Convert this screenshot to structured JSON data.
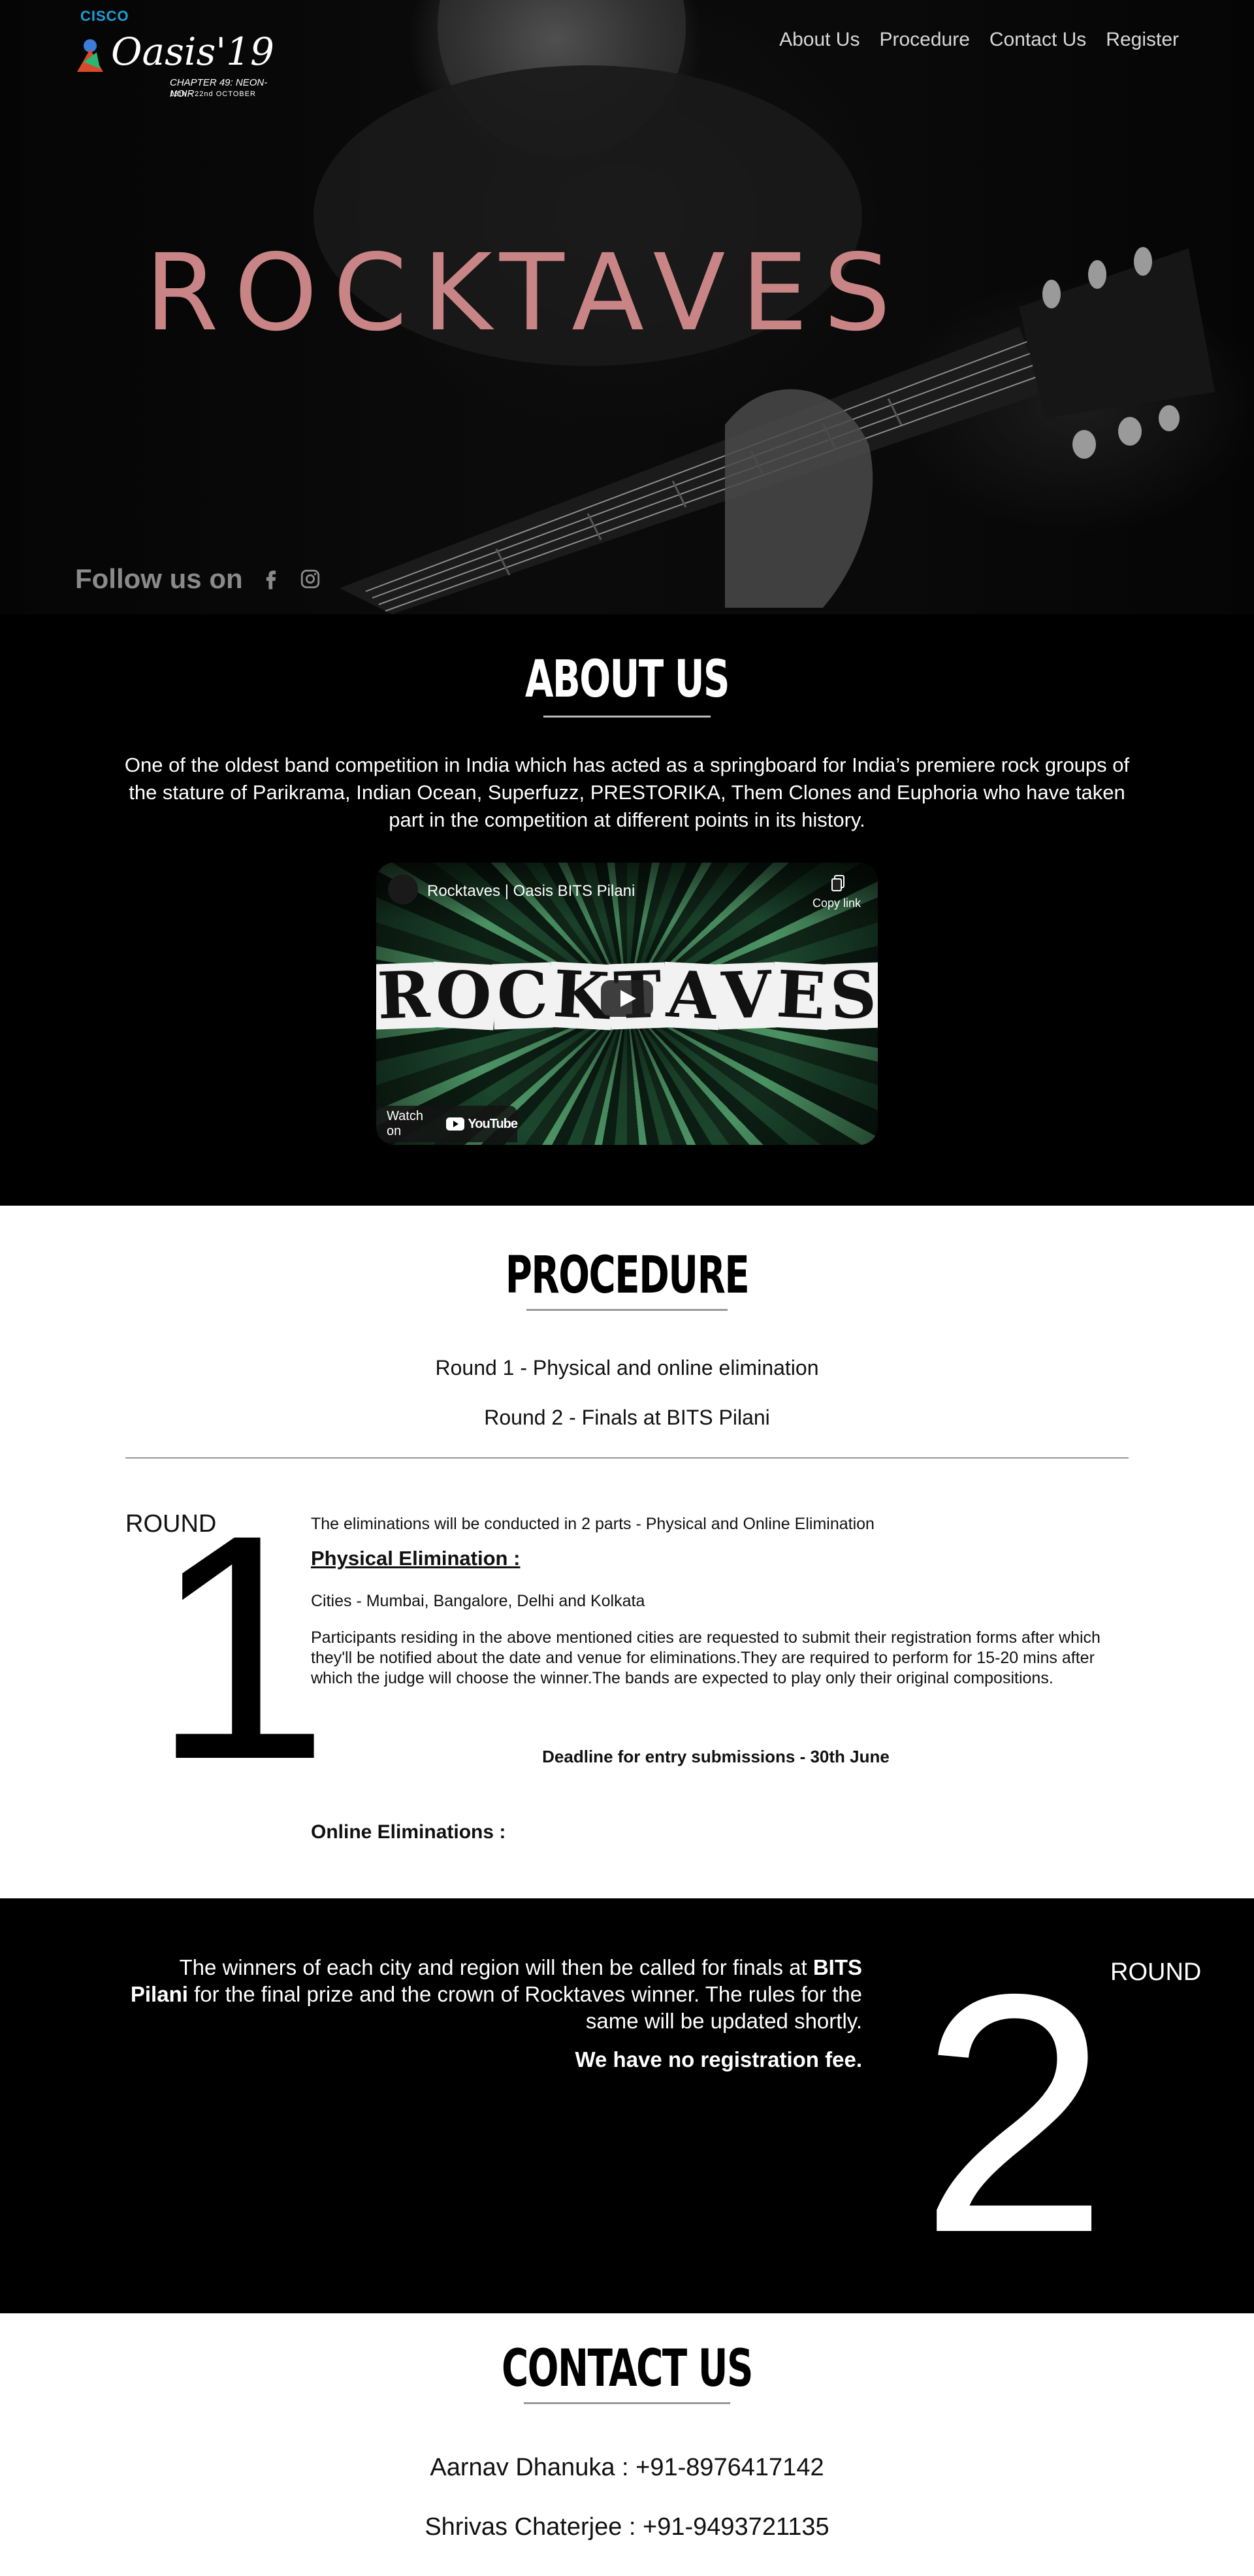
{
  "header": {
    "logo": {
      "cisco": "CISCO",
      "brand": "Oasis'19",
      "subtitle": "CHAPTER 49: NEON-NOIR",
      "dates": "15th - 22nd OCTOBER"
    },
    "nav": [
      "About Us",
      "Procedure",
      "Contact Us",
      "Register"
    ]
  },
  "hero": {
    "title": "ROCKTAVES",
    "follow_label": "Follow us on",
    "social_icons": [
      "facebook-icon",
      "instagram-icon"
    ]
  },
  "about": {
    "title": "ABOUT US",
    "text": "One of the oldest band competition in India which has acted as a springboard for India’s premiere rock groups of the stature of Parikrama, Indian Ocean, Superfuzz, PRESTORIKA, Them Clones and Euphoria who have taken part in the competition at different points in its history.",
    "video": {
      "title": "Rocktaves | Oasis BITS Pilani",
      "copy_label": "Copy link",
      "overlay_text": "ROCKTAVES",
      "watch_on": "Watch on",
      "youtube": "YouTube"
    }
  },
  "procedure": {
    "title": "PROCEDURE",
    "rounds": [
      "Round 1 - Physical and online elimination",
      "Round 2 - Finals at BITS Pilani"
    ],
    "round1": {
      "label": "ROUND",
      "number": "1",
      "intro": "The eliminations will be conducted in 2 parts - Physical and Online Elimination",
      "physical_heading": "Physical Elimination :",
      "cities": "Cities - Mumbai, Bangalore, Delhi and Kolkata",
      "details": "Participants residing in the above mentioned cities are requested to submit their registration forms after which they'll be notified about the date and venue for eliminations.They are required to perform for 15-20 mins after which the judge will choose the winner.The bands are expected to play only their original compositions.",
      "deadline": "Deadline for entry submissions - 30th June",
      "online_heading": "Online Eliminations :"
    }
  },
  "round2": {
    "label": "ROUND",
    "number": "2",
    "text_before": "The winners of each city and region will then be called for finals at ",
    "text_bold": "BITS Pilani",
    "text_after": " for the final prize and the crown of Rocktaves winner. The rules for the same will be updated shortly.",
    "fee": "We have no registration fee."
  },
  "contact": {
    "title": "CONTACT US",
    "people": [
      "Aarnav Dhanuka : +91-8976417142",
      "Shrivas Chaterjee : +91-9493721135"
    ]
  },
  "colors": {
    "hero_title": "#c98585",
    "cisco": "#1ba0d7",
    "dark_bg": "#000000",
    "light_bg": "#ffffff"
  }
}
